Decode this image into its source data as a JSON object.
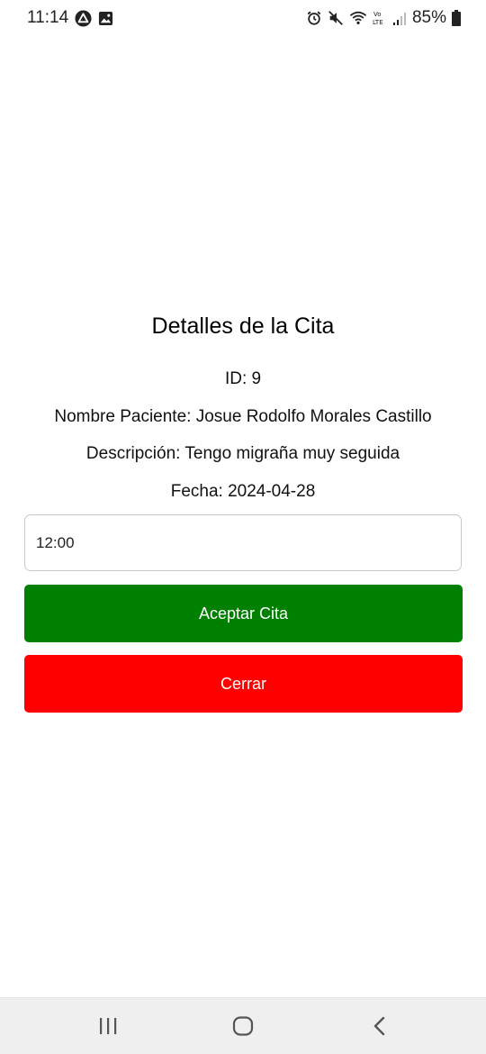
{
  "status_bar": {
    "time": "11:14",
    "battery": "85%",
    "left_icons": [
      "expo-icon",
      "gallery-icon"
    ],
    "right_icons": [
      "alarm-icon",
      "mute-icon",
      "wifi-icon",
      "volte-icon",
      "signal-icon",
      "battery-icon"
    ]
  },
  "dialog": {
    "title": "Detalles de la Cita",
    "id_text": "ID: 9",
    "patient_text": "Nombre Paciente: Josue Rodolfo Morales Castillo",
    "description_text": "Descripción: Tengo migraña muy seguida",
    "date_text": "Fecha: 2024-04-28",
    "time_input_value": "12:00",
    "accept_label": "Aceptar Cita",
    "close_label": "Cerrar"
  },
  "colors": {
    "accept": "#008000",
    "close": "#ff0000"
  },
  "nav_bar": {
    "icons": [
      "recents-icon",
      "home-icon",
      "back-icon"
    ]
  }
}
